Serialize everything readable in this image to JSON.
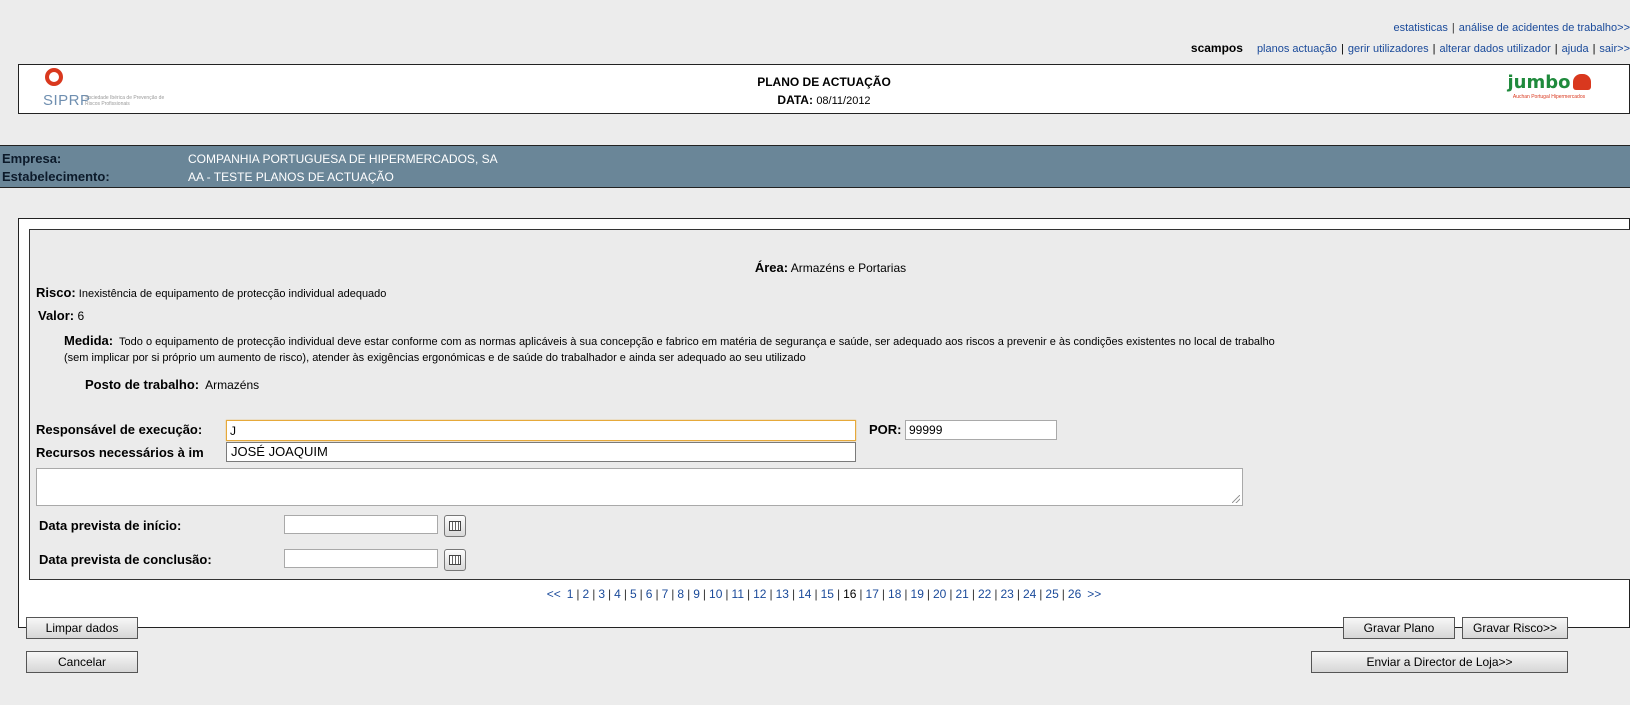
{
  "top_links": {
    "estatisticas": "estatisticas",
    "analise": "análise de acidentes de trabalho>>"
  },
  "user_bar": {
    "username": "scampos",
    "planos": "planos actuação",
    "gerir": "gerir utilizadores",
    "alterar": "alterar dados utilizador",
    "ajuda": "ajuda",
    "sair": "sair>>"
  },
  "header": {
    "logo_left": "SIPRP",
    "logo_left_small": "Sociedade Ibérica de Prevenção de Riscos Profissionais",
    "title": "PLANO DE ACTUAÇÃO",
    "date_label": "DATA:",
    "date_value": "08/11/2012",
    "logo_right": "jumbo",
    "logo_right_small": "Auchan Portugal Hipermercados"
  },
  "company": {
    "empresa_label": "Empresa:",
    "empresa_value": "COMPANHIA PORTUGUESA DE HIPERMERCADOS, SA",
    "estab_label": "Estabelecimento:",
    "estab_value": "AA - TESTE PLANOS DE ACTUAÇÃO"
  },
  "form": {
    "area_label": "Área:",
    "area_value": "Armazéns e Portarias",
    "risco_label": "Risco:",
    "risco_value": "Inexistência de equipamento de protecção individual adequado",
    "valor_label": "Valor:",
    "valor_value": "6",
    "medida_label": "Medida:",
    "medida_line1": "Todo o equipamento de protecção individual deve estar conforme com as normas aplicáveis à sua concepção e fabrico em matéria de segurança e saúde, ser adequado aos riscos a prevenir e às condições existentes no local de trabalho",
    "medida_line2": "(sem implicar por si próprio um aumento de risco), atender às exigências ergonómicas e de saúde do trabalhador e ainda ser adequado ao seu utilizado",
    "posto_label": "Posto de trabalho:",
    "posto_value": "Armazéns",
    "responsavel_label": "Responsável de execução:",
    "responsavel_value": "J",
    "suggestion": "JOSÉ JOAQUIM",
    "por_label": "POR:",
    "por_value": "99999",
    "recursos_label": "Recursos necessários à im",
    "recursos_value": "",
    "inicio_label": "Data prevista de início:",
    "inicio_value": "",
    "conclusao_label": "Data prevista de conclusão:",
    "conclusao_value": ""
  },
  "pager": {
    "prev": "<<",
    "next": ">>",
    "current": "16",
    "pages": [
      "1",
      "2",
      "3",
      "4",
      "5",
      "6",
      "7",
      "8",
      "9",
      "10",
      "11",
      "12",
      "13",
      "14",
      "15",
      "16",
      "17",
      "18",
      "19",
      "20",
      "21",
      "22",
      "23",
      "24",
      "25",
      "26"
    ]
  },
  "buttons": {
    "limpar": "Limpar dados",
    "cancelar": "Cancelar",
    "gravar_plano": "Gravar Plano",
    "gravar_risco": "Gravar Risco>>",
    "enviar": "Enviar a Director de Loja>>"
  },
  "colors": {
    "company_bar": "#6a8698",
    "link": "#1a4a9a",
    "input_focus": "#e6a93a"
  }
}
